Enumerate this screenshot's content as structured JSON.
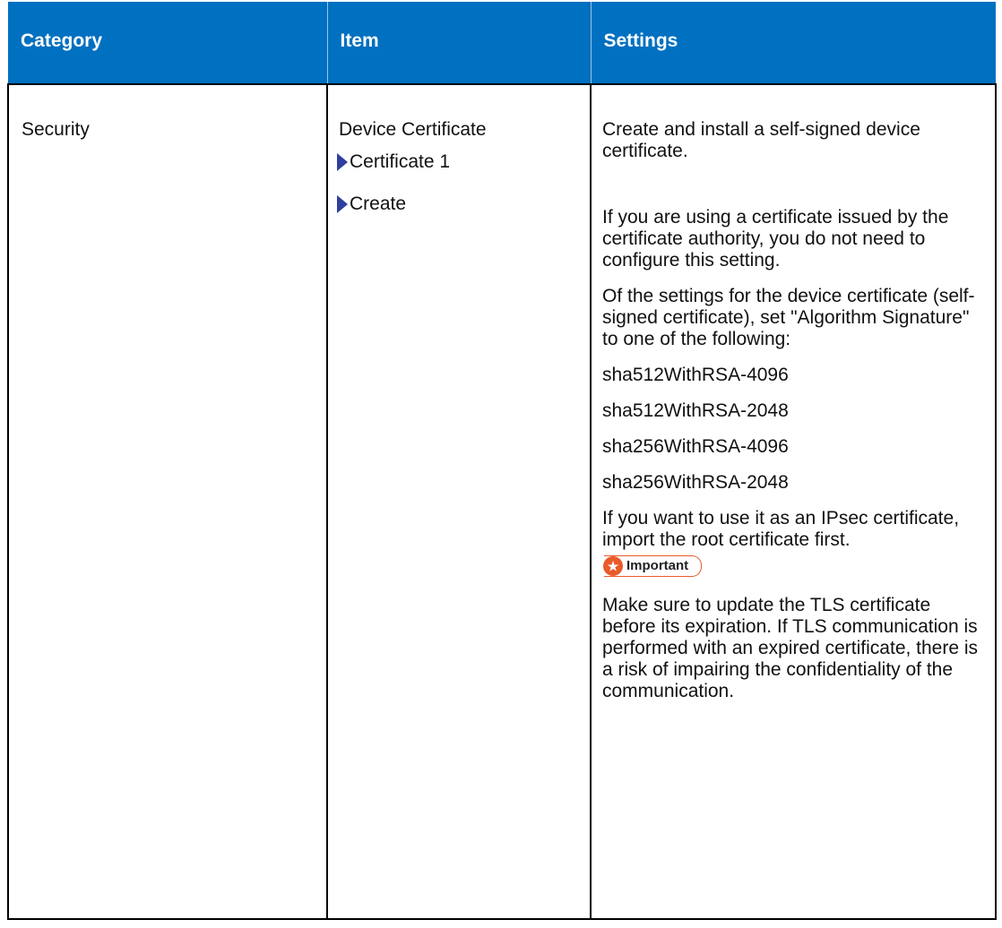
{
  "table": {
    "headers": [
      "Category",
      "Item",
      "Settings"
    ],
    "row": {
      "category": "Security",
      "item": {
        "title": "Device Certificate",
        "steps": [
          "Certificate 1",
          "Create"
        ]
      },
      "settings": {
        "p1": "Create and install a self-signed device certificate.",
        "p2": "If you are using a certificate issued by the certificate authority, you do not need to configure this setting.",
        "p3": "Of the settings for the device certificate (self-signed certificate), set \"Algorithm Signature\" to one of the following:",
        "algorithms": [
          "sha512WithRSA-4096",
          "sha512WithRSA-2048",
          "sha256WithRSA-4096",
          "sha256WithRSA-2048"
        ],
        "p4": "If you want to use it as an IPsec certificate, import the root certificate first.",
        "important_label": "Important",
        "p5": "Make sure to update the TLS certificate before its expiration. If TLS communication is performed with an expired certificate, there is a risk of impairing the confidentiality of the communication."
      }
    }
  },
  "colors": {
    "header_bg": "#0070c0",
    "arrow": "#2f3f9f",
    "important": "#e85a2a"
  },
  "icons": {
    "step_marker": "right-triangle",
    "important_marker": "star-in-circle"
  }
}
